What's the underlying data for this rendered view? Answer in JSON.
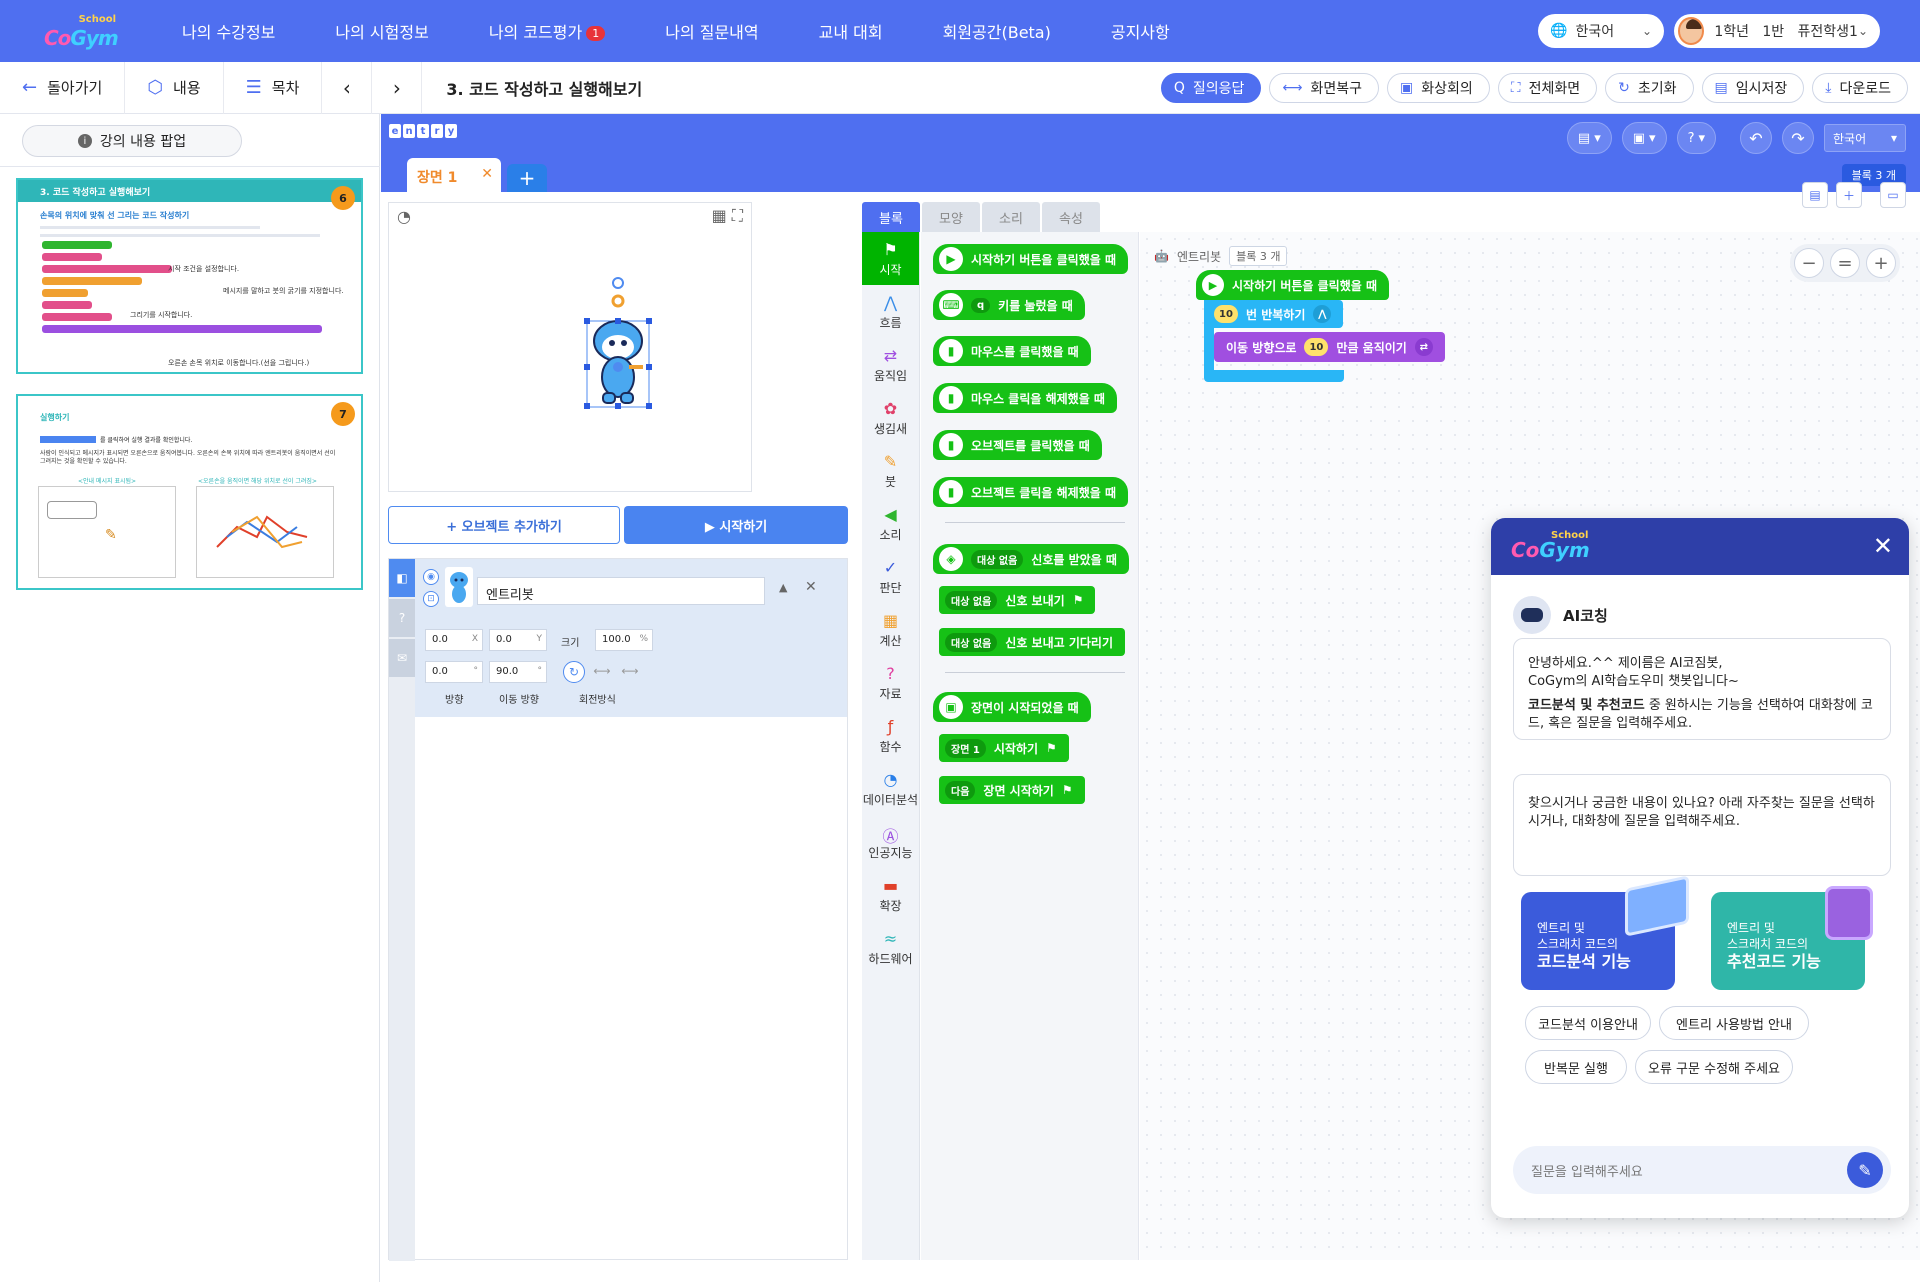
{
  "nav": {
    "logo_school": "School",
    "logo_brand_a": "Co",
    "logo_brand_b": "Gym",
    "items": [
      "나의 수강정보",
      "나의 시험정보",
      "나의 코드평가",
      "나의 질문내역",
      "교내 대회",
      "회원공간(Beta)",
      "공지사항"
    ],
    "code_eval_badge": "1",
    "language": "한국어",
    "user": "1학년   1반   퓨전학생1"
  },
  "subbar": {
    "back": "돌아가기",
    "content": "내용",
    "toc": "목차",
    "title": "3. 코드 작성하고 실행해보기",
    "tools": [
      "질의응답",
      "화면복구",
      "화상회의",
      "전체화면",
      "초기화",
      "임시저장",
      "다운로드"
    ]
  },
  "left": {
    "popup_label": "강의 내용 팝업",
    "slide6": {
      "number": "6",
      "header": "3. 코드 작성하고 실행해보기",
      "subtitle": "손목의 위치에 맞춰 선 그리는 코드 작성하기",
      "notes": [
        "시작 조건을 설정합니다.",
        "메시지를 말하고 붓의 굵기를 지정합니다.",
        "그리기를 시작합니다.",
        "오른손 손목 위치로 이동합니다.(선을 그립니다.)"
      ]
    },
    "slide7": {
      "number": "7",
      "header": "실행하기",
      "line1": "를 클릭하여 실행 결과를 확인합니다.",
      "line2": "사람이 인식되고 메시지가 표시되면 오른손으로 움직여봅니다. 오른손의 손목 위치에 따라 엔트리봇이 움직이면서 선이 그려지는 것을 확인할 수 있습니다.",
      "caption_left": "<안내 메시지 표시됨>",
      "caption_right": "<오른손을 움직이면 해당 위치로 선이 그려짐>"
    }
  },
  "editor": {
    "logo": [
      "e",
      "n",
      "t",
      "r",
      "y"
    ],
    "scene": "장면 1",
    "language": "한국어",
    "block_count": "블록 3 개",
    "add_object": "+ 오브젝트 추가하기",
    "start": "▶ 시작하기",
    "object": {
      "name": "엔트리봇",
      "x": "0.0",
      "x_unit": "X",
      "y": "0.0",
      "y_unit": "Y",
      "size_label": "크기",
      "size": "100.0",
      "size_unit": "%",
      "dir": "0.0",
      "dir_unit": "°",
      "move_dir": "90.0",
      "move_dir_unit": "°",
      "dir_label": "방향",
      "move_dir_label": "이동 방향",
      "rotate_label": "회전방식"
    },
    "tabs": [
      "블록",
      "모양",
      "소리",
      "속성"
    ],
    "categories": [
      "시작",
      "흐름",
      "움직임",
      "생김새",
      "붓",
      "소리",
      "판단",
      "계산",
      "자료",
      "함수",
      "데이터분석",
      "인공지능",
      "확장",
      "하드웨어"
    ],
    "blocks": {
      "b1": "시작하기 버튼을 클릭했을 때",
      "b2_key": "q",
      "b2": "키를 눌렀을 때",
      "b3": "마우스를 클릭했을 때",
      "b4": "마우스 클릭을 해제했을 때",
      "b5": "오브젝트를 클릭했을 때",
      "b6": "오브젝트 클릭을 해제했을 때",
      "target": "대상 없음",
      "b7": "신호를 받았을 때",
      "b8": "신호 보내기",
      "b9": "신호 보내고 기다리기",
      "b10": "장면이 시작되었을 때",
      "b11_scene": "장면 1",
      "b11": "시작하기",
      "b12_opt": "다음",
      "b12": "장면 시작하기"
    },
    "workspace": {
      "object": "엔트리봇",
      "tag": "블록 3 개",
      "start": "시작하기 버튼을 클릭했을 때",
      "repeat_n": "10",
      "repeat": "번 반복하기",
      "move_pre": "이동 방향으로",
      "move_n": "10",
      "move_post": "만큼 움직이기"
    }
  },
  "chat": {
    "logo_school": "School",
    "logo_brand_a": "Co",
    "logo_brand_b": "Gym",
    "coach": "AI코칭",
    "msg1_a": "안녕하세요.^^ 제이름은 AI코짐봇,",
    "msg1_b": "CoGym의 AI학습도우미 챗봇입니다~",
    "msg1_c_bold": "코드분석 및 추천코드",
    "msg1_c": " 중 원하시는 기능을 선택하여 대화창에 코드, 혹은 질문을 입력해주세요.",
    "msg2": "찾으시거나 궁금한 내용이 있나요? 아래 자주찾는 질문을 선택하시거나, 대화창에 질문을 입력해주세요.",
    "card1_a": "엔트리 및",
    "card1_b": "스크래치 코드의",
    "card1_c": "코드분석 기능",
    "card2_a": "엔트리 및",
    "card2_b": "스크래치 코드의",
    "card2_c": "추천코드 기능",
    "chips": [
      "코드분석 이용안내",
      "엔트리 사용방법 안내",
      "반복문 실행",
      "오류 구문 수정해 주세요"
    ],
    "placeholder": "질문을 입력해주세요"
  }
}
